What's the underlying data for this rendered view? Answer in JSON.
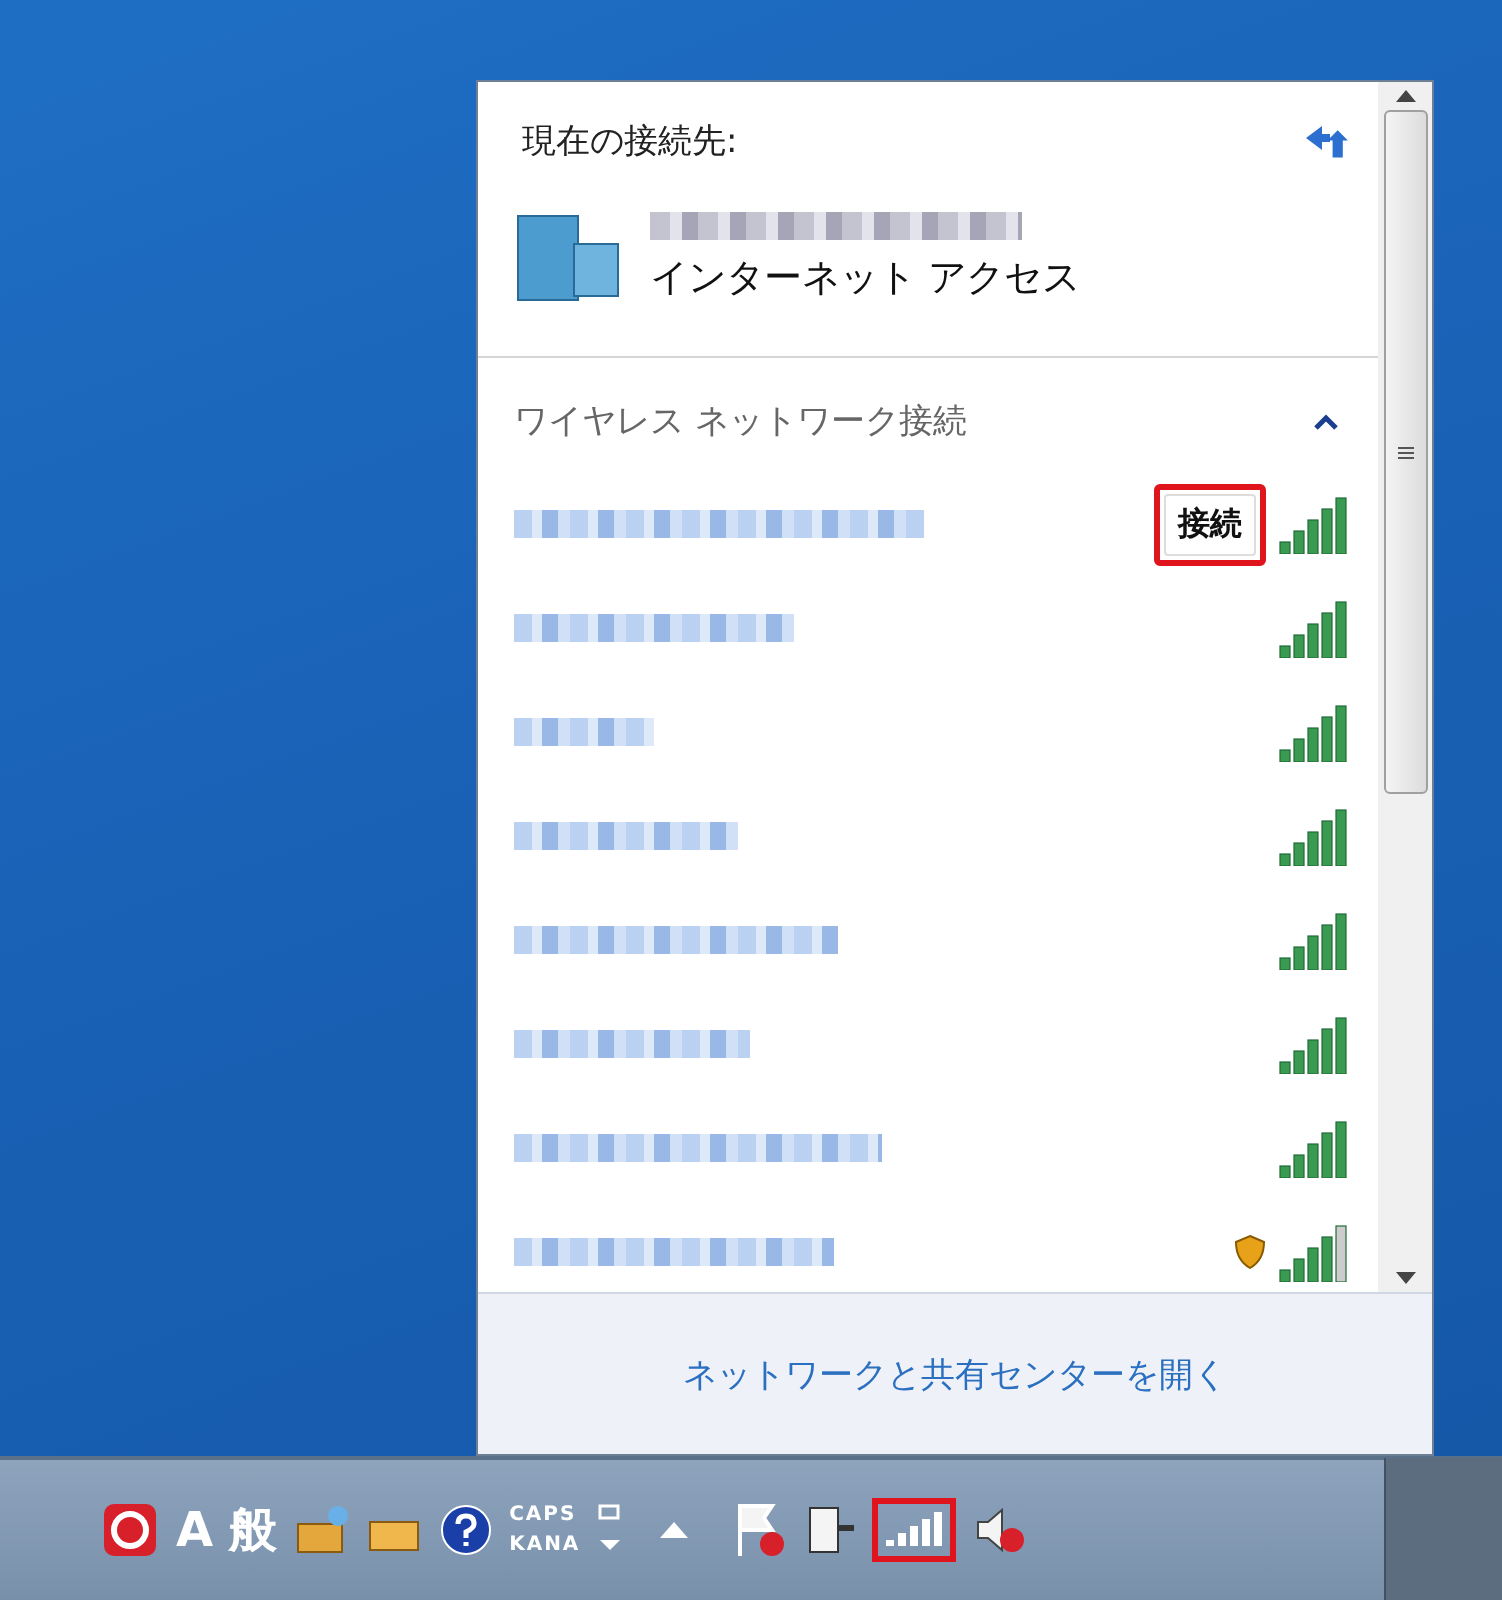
{
  "panel": {
    "title": "現在の接続先:",
    "connection_status": "インターネット アクセス"
  },
  "wireless_section": {
    "title": "ワイヤレス ネットワーク接続",
    "expanded": true
  },
  "networks": [
    {
      "connect_label": "接続",
      "highlighted": true,
      "warning": false
    },
    {
      "warning": false
    },
    {
      "warning": false
    },
    {
      "warning": false
    },
    {
      "warning": false
    },
    {
      "warning": false
    },
    {
      "warning": false
    },
    {
      "warning": true
    }
  ],
  "footer_link": "ネットワークと共有センターを開く",
  "taskbar": {
    "ime_mode": "A",
    "ime_kanji": "般",
    "caps": "CAPS",
    "kana": "KANA",
    "wifi_highlighted": true
  }
}
